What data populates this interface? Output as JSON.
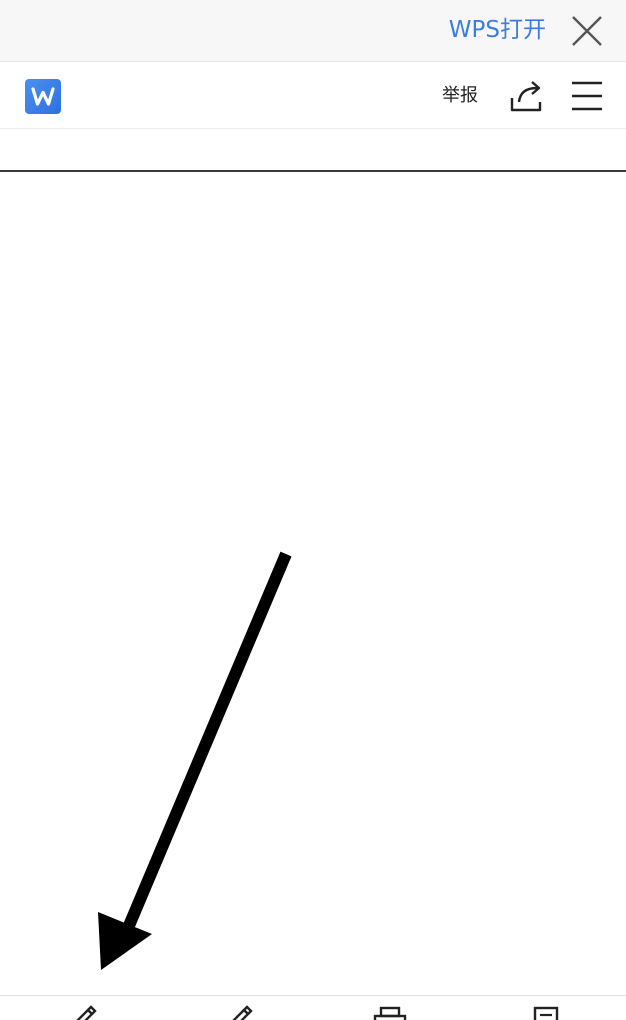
{
  "banner": {
    "open_label": "WPS打开",
    "close_icon": "close-icon"
  },
  "header": {
    "logo_icon": "wps-writer-logo-icon",
    "report_label": "举报",
    "share_icon": "share-icon",
    "menu_icon": "hamburger-menu-icon"
  },
  "toolbar": {
    "tools": [
      {
        "icon": "pen-icon"
      },
      {
        "icon": "pen-icon"
      },
      {
        "icon": "printer-icon"
      },
      {
        "icon": "document-icon"
      }
    ]
  },
  "colors": {
    "accent": "#3b7de0",
    "logo": "#3a83ec",
    "arrow": "#000000"
  }
}
